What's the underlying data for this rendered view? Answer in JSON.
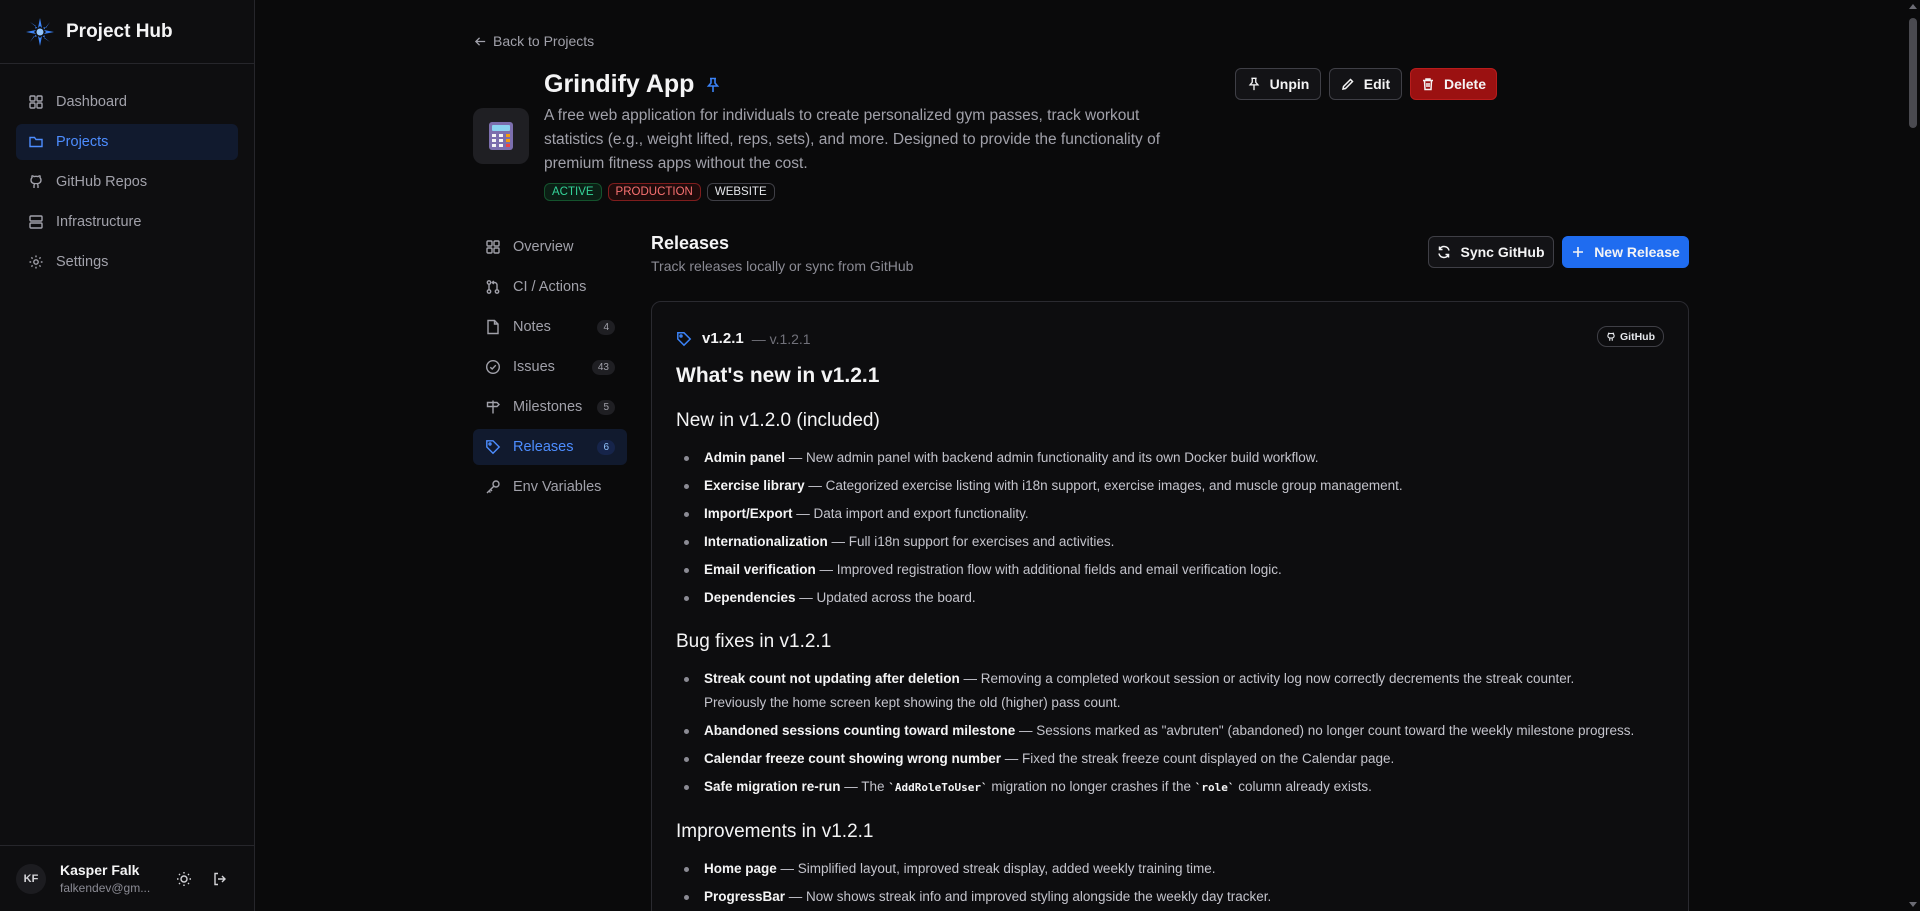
{
  "app": {
    "name": "Project Hub"
  },
  "sidebar": {
    "items": [
      {
        "label": "Dashboard",
        "icon": "grid-icon"
      },
      {
        "label": "Projects",
        "icon": "folder-icon",
        "active": true
      },
      {
        "label": "GitHub Repos",
        "icon": "github-icon"
      },
      {
        "label": "Infrastructure",
        "icon": "server-icon"
      },
      {
        "label": "Settings",
        "icon": "gear-icon"
      }
    ]
  },
  "user": {
    "initials": "KF",
    "name": "Kasper Falk",
    "email": "falkendev@gm..."
  },
  "back_label": "Back to Projects",
  "project": {
    "title": "Grindify App",
    "description": "A free web application for individuals to create personalized gym passes, track workout statistics (e.g., weight lifted, reps, sets), and more. Designed to provide the functionality of premium fitness apps without the cost.",
    "tags": [
      "ACTIVE",
      "PRODUCTION",
      "WEBSITE"
    ]
  },
  "actions": {
    "unpin": "Unpin",
    "edit": "Edit",
    "delete": "Delete"
  },
  "subnav": [
    {
      "label": "Overview",
      "icon": "grid-icon",
      "count": ""
    },
    {
      "label": "CI / Actions",
      "icon": "git-pull-request-icon",
      "count": ""
    },
    {
      "label": "Notes",
      "icon": "file-icon",
      "count": "4"
    },
    {
      "label": "Issues",
      "icon": "check-circle-icon",
      "count": "43"
    },
    {
      "label": "Milestones",
      "icon": "signpost-icon",
      "count": "5"
    },
    {
      "label": "Releases",
      "icon": "tag-icon",
      "count": "6",
      "active": true
    },
    {
      "label": "Env Variables",
      "icon": "key-icon",
      "count": ""
    }
  ],
  "releases": {
    "title": "Releases",
    "subtitle": "Track releases locally or sync from GitHub",
    "sync_label": "Sync GitHub",
    "new_label": "New Release"
  },
  "release": {
    "name": "v1.2.1",
    "tag": "— v.1.2.1",
    "source_badge": "GitHub",
    "heading": "What's new in v1.2.1",
    "sections": [
      {
        "title": "New in v1.2.0 (included)",
        "items": [
          {
            "bold": "Admin panel",
            "text": " — New admin panel with backend admin functionality and its own Docker build workflow."
          },
          {
            "bold": "Exercise library",
            "text": " — Categorized exercise listing with i18n support, exercise images, and muscle group management."
          },
          {
            "bold": "Import/Export",
            "text": " — Data import and export functionality."
          },
          {
            "bold": "Internationalization",
            "text": " — Full i18n support for exercises and activities."
          },
          {
            "bold": "Email verification",
            "text": " — Improved registration flow with additional fields and email verification logic."
          },
          {
            "bold": "Dependencies",
            "text": " — Updated across the board."
          }
        ]
      },
      {
        "title": "Bug fixes in v1.2.1",
        "items": [
          {
            "bold": "Streak count not updating after deletion",
            "text": " — Removing a completed workout session or activity log now correctly decrements the streak counter. Previously the home screen kept showing the old (higher) pass count."
          },
          {
            "bold": "Abandoned sessions counting toward milestone",
            "text": " — Sessions marked as \"avbruten\" (abandoned) no longer count toward the weekly milestone progress."
          },
          {
            "bold": "Calendar freeze count showing wrong number",
            "text": " — Fixed the streak freeze count displayed on the Calendar page."
          },
          {
            "bold": "Safe migration re-run",
            "text": " — The ",
            "code": "`AddRoleToUser`",
            "text2": " migration no longer crashes if the ",
            "code2": "`role`",
            "text3": " column already exists."
          }
        ]
      },
      {
        "title": "Improvements in v1.2.1",
        "items": [
          {
            "bold": "Home page",
            "text": " — Simplified layout, improved streak display, added weekly training time."
          },
          {
            "bold": "ProgressBar",
            "text": " — Now shows streak info and improved styling alongside the weekly day tracker."
          }
        ]
      }
    ]
  },
  "colors": {
    "accent": "#1f6cf0",
    "danger": "#9b1111",
    "background": "#0a0a0b"
  }
}
